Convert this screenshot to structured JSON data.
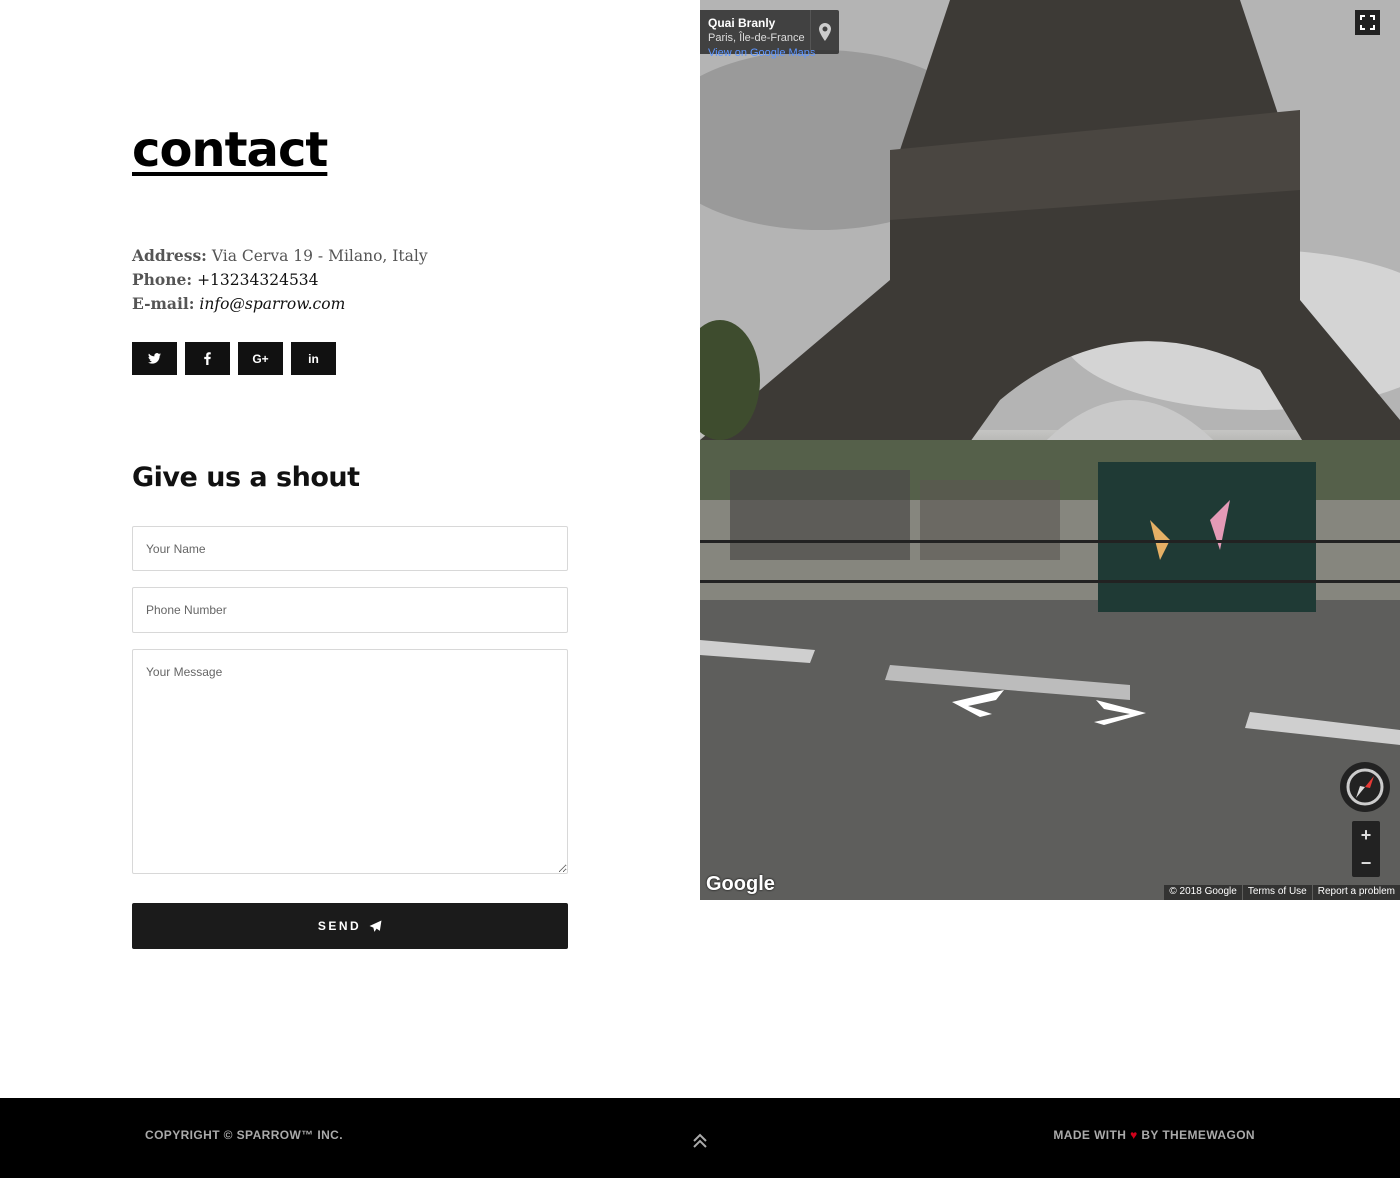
{
  "contact": {
    "heading": "contact",
    "address_label": "Address:",
    "address_value": "Via Cerva 19 - Milano, Italy",
    "phone_label": "Phone:",
    "phone_value": "+13234324534",
    "email_label": "E-mail:",
    "email_value": "info@sparrow.com"
  },
  "socials": [
    {
      "icon": "twitter-icon",
      "glyph": "🐦"
    },
    {
      "icon": "facebook-icon",
      "glyph": "f"
    },
    {
      "icon": "google-plus-icon",
      "glyph": "G+"
    },
    {
      "icon": "linkedin-icon",
      "glyph": "in"
    }
  ],
  "form": {
    "title": "Give us a shout",
    "name_placeholder": "Your Name",
    "phone_placeholder": "Phone Number",
    "message_placeholder": "Your Message",
    "send_label": "SEND"
  },
  "streetview": {
    "place_title": "Quai Branly",
    "place_subtitle": "Paris, Île-de-France",
    "place_link": "View on Google Maps",
    "logo": "Google",
    "copyright": "© 2018 Google",
    "terms": "Terms of Use",
    "report": "Report a problem",
    "zoom_in": "+",
    "zoom_out": "−"
  },
  "footer": {
    "copyright": "COPYRIGHT © SPARROW™ INC.",
    "made_prefix": "MADE WITH",
    "heart": "♥",
    "made_suffix": "BY THEMEWAGON"
  },
  "colors": {
    "accent_dark": "#111111",
    "heart": "#d0021b",
    "footer_bg": "#000000"
  }
}
